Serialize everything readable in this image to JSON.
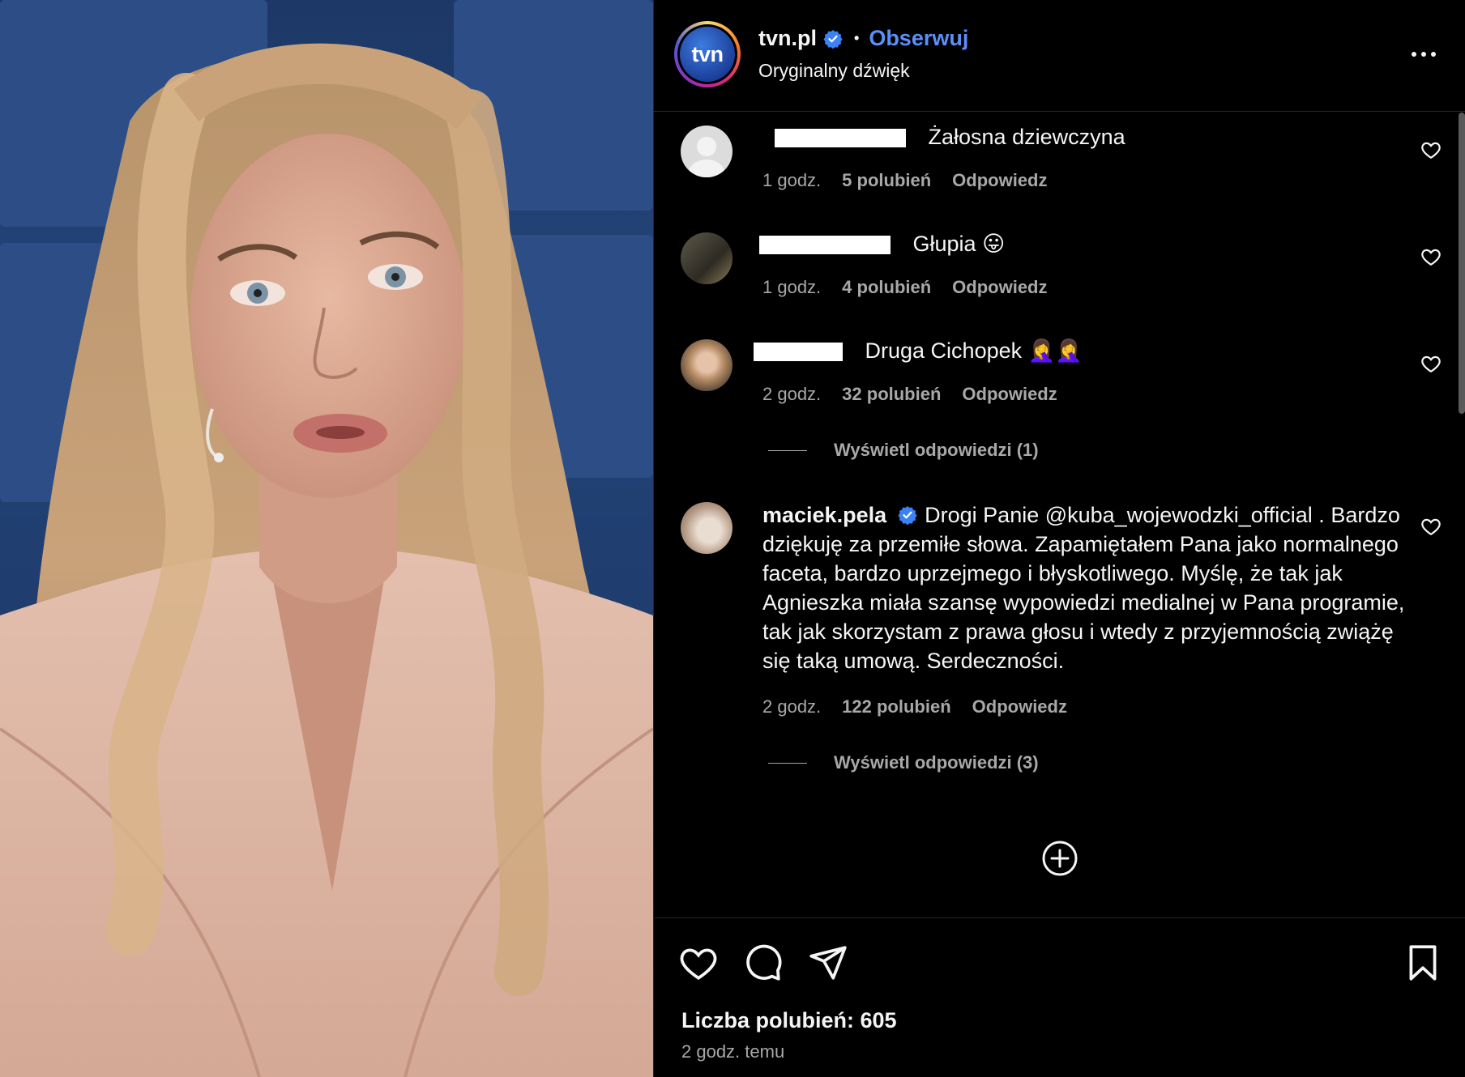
{
  "media": {
    "description_icon": "video-frame"
  },
  "header": {
    "username": "tvn.pl",
    "avatar_text": "tvn",
    "separator": "•",
    "follow_label": "Obserwuj",
    "audio": "Oryginalny dźwięk"
  },
  "comments": [
    {
      "text": "Żałosna dziewczyna",
      "time": "1 godz.",
      "likes": "5 polubień",
      "reply": "Odpowiedz"
    },
    {
      "text": "Głupia 😛",
      "time": "1 godz.",
      "likes": "4 polubień",
      "reply": "Odpowiedz"
    },
    {
      "text": "Druga Cichopek 🤦‍♀️🤦‍♀️",
      "time": "2 godz.",
      "likes": "32 polubień",
      "reply": "Odpowiedz",
      "view_replies": "Wyświetl odpowiedzi (1)"
    },
    {
      "username": "maciek.pela",
      "text": "Drogi Panie @kuba_wojewodzki_official . Bardzo dziękuję za przemiłe słowa. Zapamiętałem Pana jako normalnego faceta, bardzo uprzejmego i błyskotliwego. Myślę, że tak jak Agnieszka miała szansę wypowiedzi medialnej w Pana programie, tak jak skorzystam z prawa głosu i wtedy z przyjemnością zwiążę się taką umową. Serdeczności.",
      "time": "2 godz.",
      "likes": "122 polubień",
      "reply": "Odpowiedz",
      "view_replies": "Wyświetl odpowiedzi (3)"
    }
  ],
  "footer": {
    "likes_label": "Liczba polubień: 605",
    "time_ago": "2 godz. temu"
  },
  "colors": {
    "accent": "#5b8ff9",
    "muted": "#a8a8a8",
    "background": "#000000"
  }
}
